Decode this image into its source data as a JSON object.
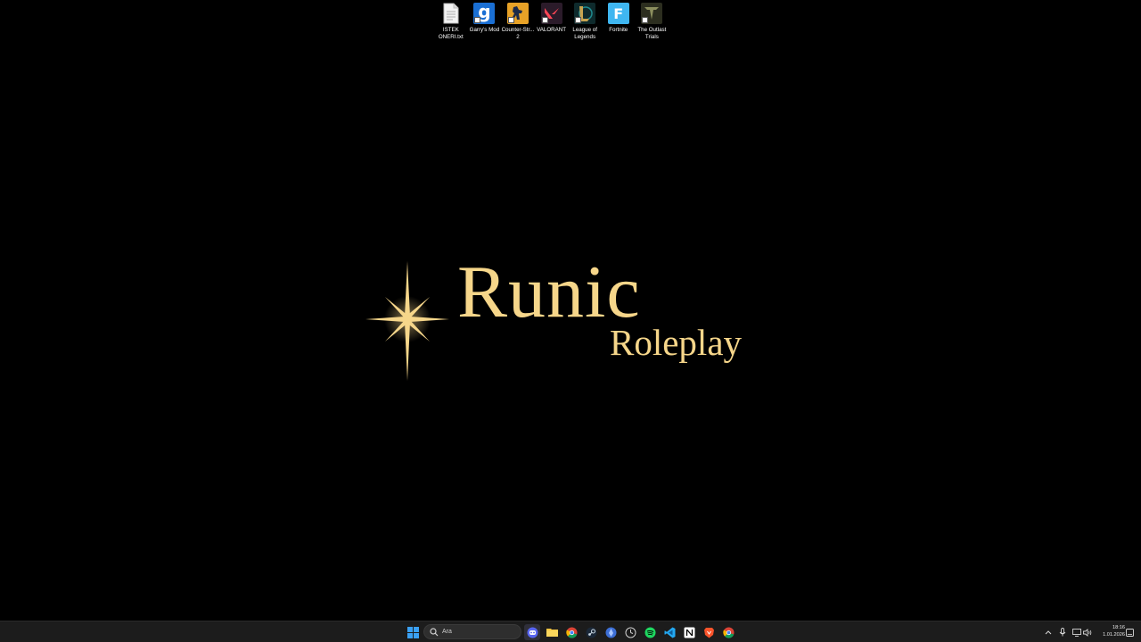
{
  "desktop": {
    "icons": [
      {
        "label": "ISTEK ONERI.txt",
        "icon": "text-file-icon",
        "color": "#e9e9e9"
      },
      {
        "label": "Garry's Mod",
        "icon": "garrys-mod-icon",
        "color": "#1a6fd4"
      },
      {
        "label": "Counter-Str... 2",
        "icon": "counter-strike-icon",
        "color": "#e7a227"
      },
      {
        "label": "VALORANT",
        "icon": "valorant-icon",
        "color": "#ff4655"
      },
      {
        "label": "League of Legends",
        "icon": "league-of-legends-icon",
        "color": "#c8a450"
      },
      {
        "label": "Fortnite",
        "icon": "fortnite-icon",
        "color": "#3fb6f0"
      },
      {
        "label": "The Outlast Trials",
        "icon": "outlast-trials-icon",
        "color": "#6b7046"
      }
    ]
  },
  "wallpaper": {
    "title": "Runic",
    "subtitle": "Roleplay",
    "accent_color": "#F6D68A"
  },
  "taskbar": {
    "search_placeholder": "Ara",
    "apps": [
      "windows-start-icon",
      "discord-icon",
      "file-explorer-icon",
      "chrome-icon",
      "steam-icon",
      "app-icon",
      "clock-app-icon",
      "spotify-icon",
      "vscode-icon",
      "notion-icon",
      "brave-icon",
      "chrome-icon"
    ],
    "clock_time": "18:16",
    "clock_date": "1.01.2026"
  }
}
